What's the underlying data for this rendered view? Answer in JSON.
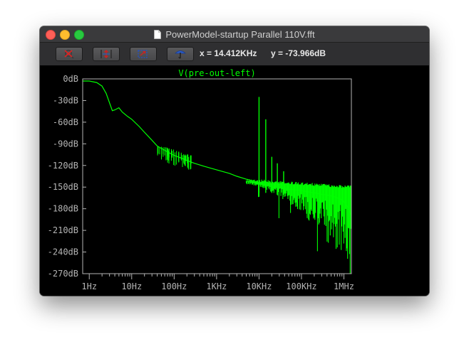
{
  "window": {
    "title": "PowerModel-startup Parallel 110V.fft"
  },
  "toolbar": {
    "buttons": [
      {
        "icon": "zoom-cancel-icon"
      },
      {
        "icon": "autorange-icon"
      },
      {
        "icon": "zoom-area-icon"
      },
      {
        "icon": "pan-icon"
      }
    ],
    "x_readout": "x = 14.412KHz",
    "y_readout": "y = -73.966dB"
  },
  "colors": {
    "trace": "#00ff00",
    "axis": "#b4b4b4",
    "background": "#000000"
  },
  "chart_data": {
    "type": "line",
    "title": "V(pre-out-left)",
    "xscale": "log",
    "xlim": [
      0.7,
      1500000
    ],
    "ylim": [
      -270,
      0
    ],
    "grid": false,
    "xticks": [
      {
        "v": 1,
        "label": "1Hz"
      },
      {
        "v": 10,
        "label": "10Hz"
      },
      {
        "v": 100,
        "label": "100Hz"
      },
      {
        "v": 1000,
        "label": "1KHz"
      },
      {
        "v": 10000,
        "label": "10KHz"
      },
      {
        "v": 100000,
        "label": "100KHz"
      },
      {
        "v": 1000000,
        "label": "1MHz"
      }
    ],
    "yticks": [
      {
        "v": 0,
        "label": "0dB"
      },
      {
        "v": -30,
        "label": "-30dB"
      },
      {
        "v": -60,
        "label": "-60dB"
      },
      {
        "v": -90,
        "label": "-90dB"
      },
      {
        "v": -120,
        "label": "-120dB"
      },
      {
        "v": -150,
        "label": "-150dB"
      },
      {
        "v": -180,
        "label": "-180dB"
      },
      {
        "v": -210,
        "label": "-210dB"
      },
      {
        "v": -240,
        "label": "-240dB"
      },
      {
        "v": -270,
        "label": "-270dB"
      }
    ],
    "series": [
      {
        "name": "V(pre-out-left)",
        "x": [
          0.7,
          1,
          1.5,
          2,
          2.5,
          3,
          3.5,
          4,
          5,
          6,
          8,
          10,
          15,
          20,
          30,
          40,
          60,
          80,
          100,
          150,
          200,
          300,
          500,
          1000,
          2000,
          3000,
          5000,
          8000,
          10000,
          15000,
          20000,
          30000,
          50000,
          100000,
          200000,
          300000,
          500000,
          800000,
          1000000,
          1300000,
          1500000
        ],
        "y": [
          -3,
          -3,
          -5,
          -10,
          -20,
          -33,
          -44,
          -43,
          -40,
          -46,
          -52,
          -56,
          -66,
          -74,
          -85,
          -93,
          -99,
          -103,
          -106,
          -110,
          -113,
          -117,
          -121,
          -126,
          -131,
          -135,
          -139,
          -142,
          -145,
          -147,
          -150,
          -151,
          -153,
          -155,
          -158,
          -160,
          -162,
          -166,
          -170,
          -180,
          -190
        ]
      }
    ],
    "spurs": [
      {
        "x": 10000,
        "y": -25
      },
      {
        "x": 14412,
        "y": -56
      },
      {
        "x": 20000,
        "y": -108
      },
      {
        "x": 27000,
        "y": -117
      },
      {
        "x": 38000,
        "y": -128
      }
    ],
    "noise_band": {
      "x_start": 5000,
      "x_end": 1500000,
      "upper_db": -138,
      "lower_db": -270
    }
  }
}
